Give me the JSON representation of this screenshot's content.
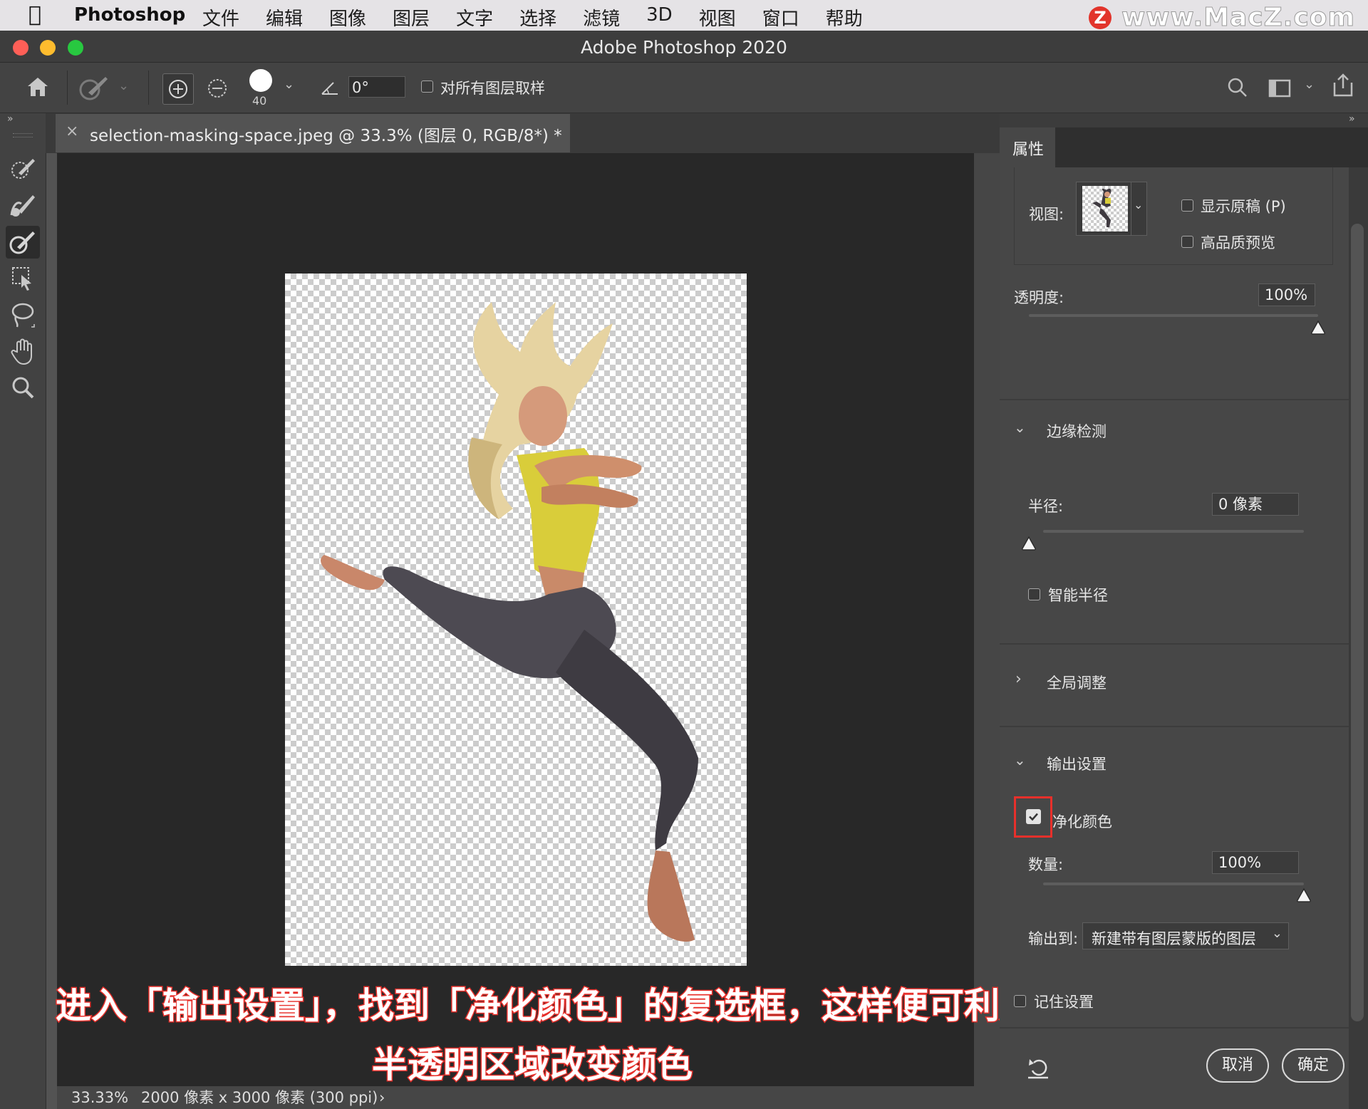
{
  "menubar": {
    "app_name": "Photoshop",
    "items": [
      "文件",
      "编辑",
      "图像",
      "图层",
      "文字",
      "选择",
      "滤镜",
      "3D",
      "视图",
      "窗口",
      "帮助"
    ],
    "watermark": "www.MacZ.com",
    "watermark_badge": "Z"
  },
  "window": {
    "title": "Adobe Photoshop 2020"
  },
  "options": {
    "brush_size": "40",
    "angle_value": "0°",
    "sample_all_layers_label": "对所有图层取样"
  },
  "document": {
    "tab_title": "selection-masking-space.jpeg @ 33.3% (图层 0, RGB/8*) *",
    "tab_close": "×"
  },
  "status": {
    "zoom": "33.33%",
    "doc_info": "2000 像素 x 3000 像素 (300 ppi)",
    "arrow": "›"
  },
  "caption": {
    "line1": "进入「输出设置」，找到「净化颜色」的复选框，这样便可利用",
    "line2": "半透明区域改变颜色"
  },
  "panel": {
    "tab_label": "属性",
    "view_label": "视图:",
    "show_original_label": "显示原稿 (P)",
    "hq_preview_label": "高品质预览",
    "opacity_label": "透明度:",
    "opacity_value": "100%",
    "opacity_level": 1.0,
    "edge_detection": {
      "title": "边缘检测",
      "radius_label": "半径:",
      "radius_value": "0 像素",
      "radius_level": 0.0,
      "smart_radius_label": "智能半径"
    },
    "global_adjust": {
      "title": "全局调整"
    },
    "output": {
      "title": "输出设置",
      "decontaminate_label": "净化颜色",
      "decontaminate_checked": true,
      "amount_label": "数量:",
      "amount_value": "100%",
      "amount_level": 1.0,
      "output_to_label": "输出到:",
      "output_to_value": "新建带有图层蒙版的图层"
    },
    "remember_label": "记住设置",
    "cancel_label": "取消",
    "ok_label": "确定"
  },
  "colors": {
    "highlight_box": "#e8302b",
    "canvas_bg": "#282828",
    "panel_bg": "#474747"
  }
}
